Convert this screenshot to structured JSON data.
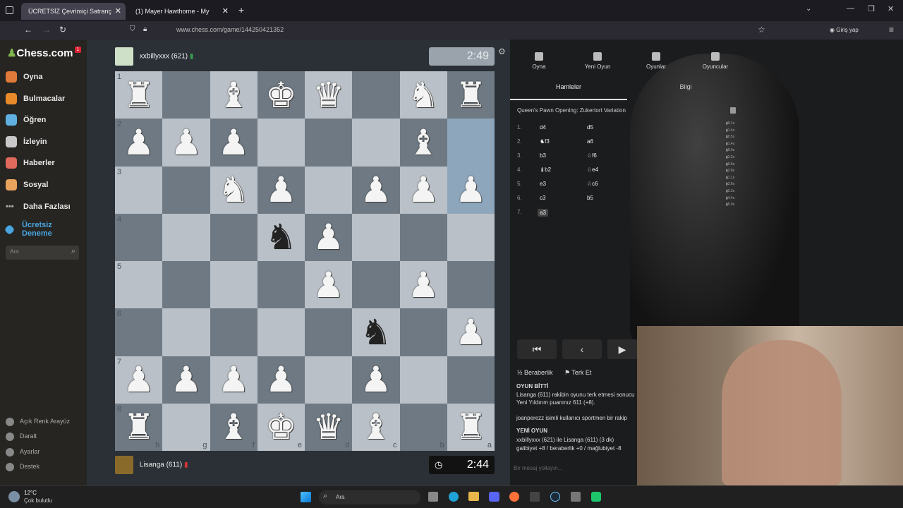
{
  "browser": {
    "tabs": [
      {
        "label": "ÜCRETSİZ Çevrimiçi Satranç"
      },
      {
        "label": "(1) Mayer Hawthorne - My"
      }
    ],
    "url": "www.chess.com/game/144250421352",
    "signin_label": "Giriş yap"
  },
  "sidebar": {
    "logo": "Chess.com",
    "notification_count": "1",
    "items": [
      {
        "label": "Oyna",
        "color": "#e07a3b"
      },
      {
        "label": "Bulmacalar",
        "color": "#e88a2a"
      },
      {
        "label": "Öğren",
        "color": "#5fb0e0"
      },
      {
        "label": "İzleyin",
        "color": "#c9c9c9"
      },
      {
        "label": "Haberler",
        "color": "#e06a5c"
      },
      {
        "label": "Sosyal",
        "color": "#e8a35c"
      },
      {
        "label": "Daha Fazlası",
        "color": "#aaaaaa"
      }
    ],
    "trial_label": "Ücretsiz Deneme",
    "search_placeholder": "Ara",
    "footer": [
      {
        "label": "Açık Renk Arayüz"
      },
      {
        "label": "Daralt"
      },
      {
        "label": "Ayarlar"
      },
      {
        "label": "Destek"
      }
    ]
  },
  "game": {
    "top_player": {
      "name": "xxbillyxxx (621)",
      "clock": "2:49"
    },
    "bottom_player": {
      "name": "Lisanga (611)",
      "clock": "2:44"
    },
    "ranks": [
      "1",
      "2",
      "3",
      "4",
      "5",
      "6",
      "7",
      "8"
    ],
    "files": [
      "h",
      "g",
      "f",
      "e",
      "d",
      "c",
      "b",
      "a"
    ],
    "board": [
      [
        "wR",
        "",
        "wB",
        "wK",
        "wQ",
        "",
        "wN",
        "wR"
      ],
      [
        "wP",
        "wP",
        "wP",
        "",
        "",
        "",
        "wB",
        ""
      ],
      [
        "",
        "",
        "wN",
        "wP",
        "",
        "wP",
        "wP",
        "wP"
      ],
      [
        "",
        "",
        "",
        "bN",
        "wP",
        "",
        "",
        ""
      ],
      [
        "",
        "",
        "",
        "",
        "wP",
        "",
        "wP",
        ""
      ],
      [
        "",
        "",
        "",
        "",
        "",
        "bN",
        "",
        "wP"
      ],
      [
        "wP",
        "wP",
        "wP",
        "wP",
        "",
        "wP",
        "",
        ""
      ],
      [
        "wR",
        "",
        "wB",
        "wK",
        "wQ",
        "wB",
        "",
        "wR"
      ]
    ]
  },
  "panel": {
    "tabs": [
      {
        "label": "Oyna"
      },
      {
        "label": "Yeni Oyun"
      },
      {
        "label": "Oyunlar"
      },
      {
        "label": "Oyuncular"
      }
    ],
    "subtabs": [
      {
        "label": "Hamleler"
      },
      {
        "label": "Bilgi"
      }
    ],
    "opening": "Queen's Pawn Opening: Zukertort Variation",
    "moves": [
      {
        "num": "1.",
        "white": "d4",
        "black": "d5"
      },
      {
        "num": "2.",
        "white": "♞f3",
        "black": "a6"
      },
      {
        "num": "3.",
        "white": "b3",
        "black": "♘f6"
      },
      {
        "num": "4.",
        "white": "♝b2",
        "black": "♘e4"
      },
      {
        "num": "5.",
        "white": "e3",
        "black": "♘c6"
      },
      {
        "num": "6.",
        "white": "c3",
        "black": "b5"
      },
      {
        "num": "7.",
        "white": "a3",
        "black": ""
      }
    ],
    "times": [
      "0.1s",
      "1.4s",
      "0.5s",
      "1.4s",
      "0.6s",
      "2.2s",
      "0.6s",
      "2.8s",
      "1.1s",
      "3.6s",
      "2.2s",
      "4.4s",
      "5.0s"
    ],
    "draw_label": "Beraberlik",
    "resign_label": "Terk Et",
    "chat": [
      "OYUN BİTTİ",
      "Lisanga (611) rakibin oyunu terk etmesi sonucu",
      "Yeni Yıldırım puanınız 611 (+8).",
      "joanperezz isimli kullanıcı sportmen bir rakip",
      "YENİ OYUN",
      "xxbillyxxx (621) ile Lisanga (611) (3 dk)",
      "galibiyet +8 / beraberlik +0 / mağlubiyet -8"
    ],
    "message_placeholder": "Bir mesaj yollayın..."
  },
  "taskbar": {
    "temp": "12°C",
    "weather": "Çok bulutlu",
    "search_label": "Ara"
  }
}
